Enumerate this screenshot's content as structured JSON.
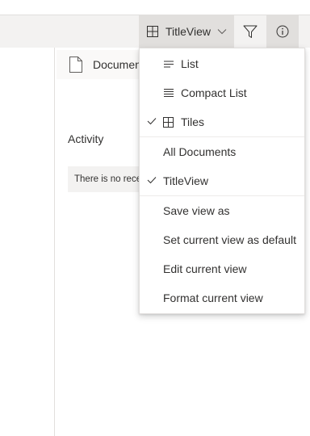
{
  "command_bar": {
    "view_button_label": "TitleView",
    "view_icon": "tiles-icon",
    "filter_icon": "filter-icon",
    "info_icon": "info-icon"
  },
  "content": {
    "document_tile_label": "Documents",
    "activity_heading": "Activity",
    "activity_message": "There is no recent activity"
  },
  "view_menu": {
    "layout_items": [
      {
        "label": "List",
        "icon": "list-icon",
        "checked": false
      },
      {
        "label": "Compact List",
        "icon": "compact-list-icon",
        "checked": false
      },
      {
        "label": "Tiles",
        "icon": "tiles-icon",
        "checked": true
      }
    ],
    "view_items": [
      {
        "label": "All Documents",
        "checked": false
      },
      {
        "label": "TitleView",
        "checked": true
      }
    ],
    "action_items": [
      {
        "label": "Save view as"
      },
      {
        "label": "Set current view as default"
      },
      {
        "label": "Edit current view"
      },
      {
        "label": "Format current view"
      }
    ]
  },
  "colors": {
    "command_bar_bg": "#f3f2f1",
    "button_active_bg": "#e1dfdd",
    "text": "#323130",
    "divider": "#e1dfdd"
  }
}
